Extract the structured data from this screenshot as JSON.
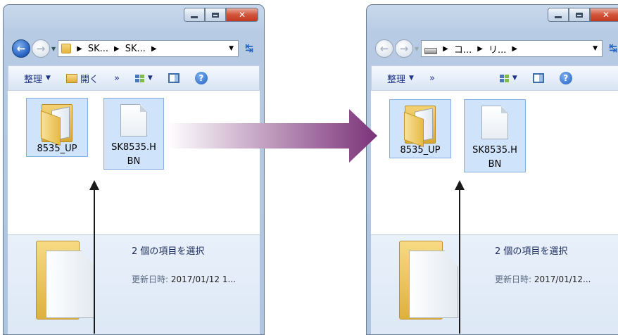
{
  "left_window": {
    "address": {
      "parts": [
        "SK...",
        "SK..."
      ]
    },
    "toolbar": {
      "organize": "整理",
      "open": "開く",
      "more": "»"
    },
    "items": [
      {
        "name": "8535_UP",
        "type": "folder"
      },
      {
        "name": "SK8535.HBN",
        "line1": "SK8535.H",
        "line2": "BN",
        "type": "file"
      }
    ],
    "details": {
      "selection": "2 個の項目を選択",
      "modified_label": "更新日時:",
      "modified_value": "2017/01/12 1..."
    }
  },
  "right_window": {
    "address": {
      "parts": [
        "コ...",
        "リ..."
      ]
    },
    "toolbar": {
      "organize": "整理",
      "more": "»"
    },
    "items": [
      {
        "name": "8535_UP",
        "type": "folder"
      },
      {
        "name": "SK8535.HBN",
        "line1": "SK8535.H",
        "line2": "BN",
        "type": "file"
      }
    ],
    "details": {
      "selection": "2 個の項目を選択",
      "modified_label": "更新日時:",
      "modified_value": "2017/01/12..."
    }
  },
  "colors": {
    "copy_arrow_start": "#ffffff",
    "copy_arrow_end": "#7b3279",
    "selection_fill": "#cfe3fb"
  }
}
